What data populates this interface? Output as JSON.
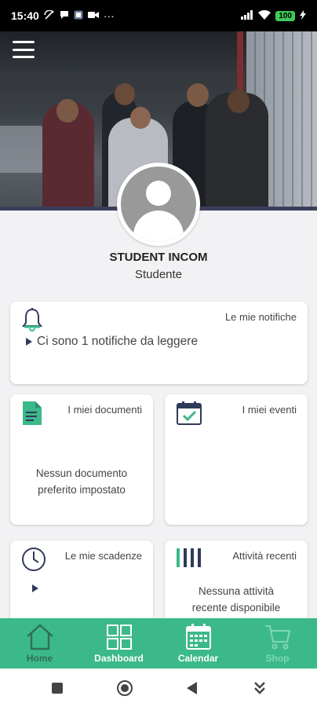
{
  "status_bar": {
    "time": "15:40",
    "more": "···",
    "battery": "100"
  },
  "user": {
    "name": "STUDENT INCOM",
    "role": "Studente"
  },
  "cards": {
    "notifications": {
      "title": "Le mie notifiche",
      "message": "Ci sono 1 notifiche da leggere"
    },
    "documents": {
      "title": "I miei documenti",
      "empty": "Nessun documento preferito impostato"
    },
    "events": {
      "title": "I miei eventi"
    },
    "deadlines": {
      "title": "Le mie scadenze"
    },
    "activities": {
      "title": "Attività recenti",
      "empty": "Nessuna attività recente disponibile"
    }
  },
  "bottom_nav": {
    "items": [
      {
        "label": "Home",
        "icon": "home-icon",
        "state": "active"
      },
      {
        "label": "Dashboard",
        "icon": "grid-icon",
        "state": "normal"
      },
      {
        "label": "Calendar",
        "icon": "calendar-icon",
        "state": "normal"
      },
      {
        "label": "Shop",
        "icon": "cart-icon",
        "state": "disabled"
      }
    ]
  },
  "colors": {
    "accent": "#3cb98a",
    "active_tab": "#2f6f55",
    "icon_dark": "#2f3a5a"
  }
}
